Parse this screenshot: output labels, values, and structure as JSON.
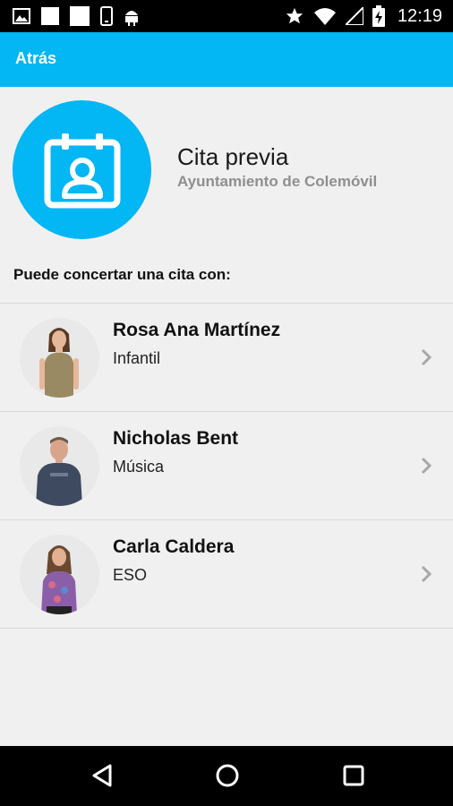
{
  "status_bar": {
    "time": "12:19",
    "left_icons": [
      "image-icon",
      "square-icon",
      "square-icon",
      "phone-icon",
      "android-icon"
    ],
    "right_icons": [
      "star-icon",
      "wifi-icon",
      "signal-icon",
      "battery-charging-icon"
    ]
  },
  "app_bar": {
    "back_label": "Atrás",
    "color": "#03b6f4"
  },
  "header": {
    "icon": "calendar-person-icon",
    "title": "Cita previa",
    "subtitle": "Ayuntamiento de Colemóvil"
  },
  "intro_text": "Puede concertar una cita con:",
  "contacts": [
    {
      "name": "Rosa Ana Martínez",
      "department": "Infantil"
    },
    {
      "name": "Nicholas Bent",
      "department": "Música"
    },
    {
      "name": "Carla Caldera",
      "department": "ESO"
    }
  ],
  "nav_bar": {
    "icons": [
      "back-triangle-icon",
      "home-circle-icon",
      "recents-square-icon"
    ]
  }
}
